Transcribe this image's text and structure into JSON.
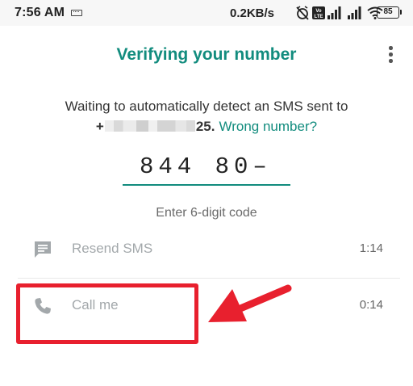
{
  "status_bar": {
    "time": "7:56 AM",
    "network_speed": "0.2KB/s",
    "volte_badge": "Vo LTE",
    "battery_level": "85",
    "icons": [
      "keyboard-icon",
      "alarm-off-icon",
      "volte-icon",
      "signal-icon",
      "signal-icon",
      "wifi-icon",
      "battery-icon"
    ]
  },
  "header": {
    "title": "Verifying your number",
    "menu_icon": "more-vert-icon"
  },
  "instruction": {
    "text": "Waiting to automatically detect an SMS sent to",
    "phone_prefix": "+",
    "phone_suffix": "25.",
    "wrong_number_link": "Wrong number?"
  },
  "code_entry": {
    "value": "844 80–",
    "hint": "Enter 6-digit code"
  },
  "options": [
    {
      "label": "Resend SMS",
      "timer": "1:14",
      "icon": "message-icon"
    },
    {
      "label": "Call me",
      "timer": "0:14",
      "icon": "phone-icon"
    }
  ],
  "colors": {
    "accent": "#128c7e",
    "annotation": "#e8202e",
    "disabled_text": "#a3a8ab"
  }
}
